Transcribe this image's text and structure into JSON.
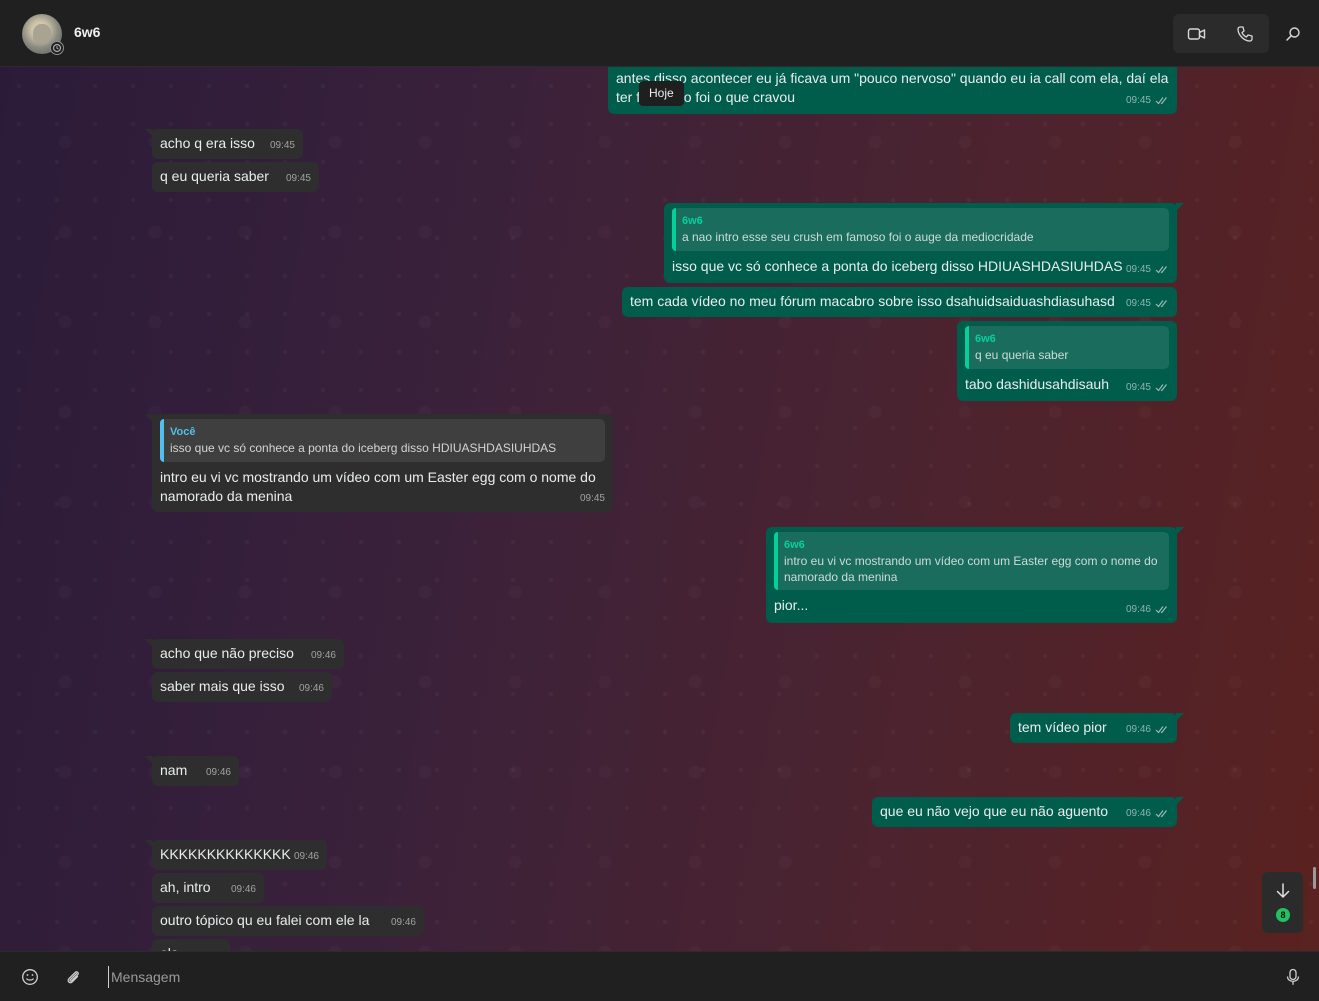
{
  "header": {
    "contact_name": "6w6",
    "icons": {
      "video": "video-camera-icon",
      "call": "phone-icon",
      "search": "search-icon"
    }
  },
  "chat": {
    "date_label": "Hoje",
    "messages": [
      {
        "dir": "out",
        "text": "antes disso acontecer eu já ficava um \"pouco nervoso\" quando eu ia call com ela, daí ela ter feito isso foi o que cravou",
        "time": "09:45"
      },
      {
        "dir": "in",
        "text": "acho q era isso",
        "time": "09:45"
      },
      {
        "dir": "in",
        "text": "q eu queria saber",
        "time": "09:45"
      },
      {
        "dir": "out",
        "quote_author": "6w6",
        "quote_text": "a nao intro esse seu crush em famoso foi o auge da mediocridade",
        "text": "isso que vc só conhece a ponta do iceberg disso HDIUASHDASIUHDAS",
        "time": "09:45"
      },
      {
        "dir": "out",
        "text": "tem cada vídeo no meu fórum macabro sobre isso dsahuidsaiduashdiasuhasd",
        "time": "09:45"
      },
      {
        "dir": "out",
        "quote_author": "6w6",
        "quote_text": "q eu queria saber",
        "text": "tabo dashidusahdisauh",
        "time": "09:45"
      },
      {
        "dir": "in",
        "quote_author": "Você",
        "quote_text": "isso que vc só conhece a ponta do iceberg disso HDIUASHDASIUHDAS",
        "text": "intro eu vi vc mostrando um vídeo com um Easter egg com o nome do namorado da menina",
        "time": "09:45"
      },
      {
        "dir": "out",
        "quote_author": "6w6",
        "quote_text": "intro eu vi vc mostrando um vídeo com um Easter egg com o nome do namorado da menina",
        "text": "pior...",
        "time": "09:46"
      },
      {
        "dir": "in",
        "text": "acho que não preciso",
        "time": "09:46"
      },
      {
        "dir": "in",
        "text": "saber mais que isso",
        "time": "09:46"
      },
      {
        "dir": "out",
        "text": "tem vídeo pior",
        "time": "09:46"
      },
      {
        "dir": "in",
        "text": "nam",
        "time": "09:46"
      },
      {
        "dir": "out",
        "text": "que eu não vejo que eu não aguento",
        "time": "09:46"
      },
      {
        "dir": "in",
        "text": "KKKKKKKKKKKKKK",
        "time": "09:46"
      },
      {
        "dir": "in",
        "text": "ah, intro",
        "time": "09:46"
      },
      {
        "dir": "in",
        "text": "outro tópico qu eu falei com ele la",
        "time": "09:46"
      },
      {
        "dir": "in",
        "text": "ela",
        "time": ""
      }
    ],
    "unread_count": "8"
  },
  "composer": {
    "placeholder": "Mensagem",
    "icons": {
      "emoji": "emoji-icon",
      "attach": "paperclip-icon",
      "mic": "microphone-icon"
    }
  },
  "colors": {
    "incoming_bubble": "#2e2e2e",
    "outgoing_bubble": "#005c4b",
    "quote_accent_out": "#06cf9c",
    "quote_accent_in": "#53bdeb",
    "badge": "#21c063"
  }
}
